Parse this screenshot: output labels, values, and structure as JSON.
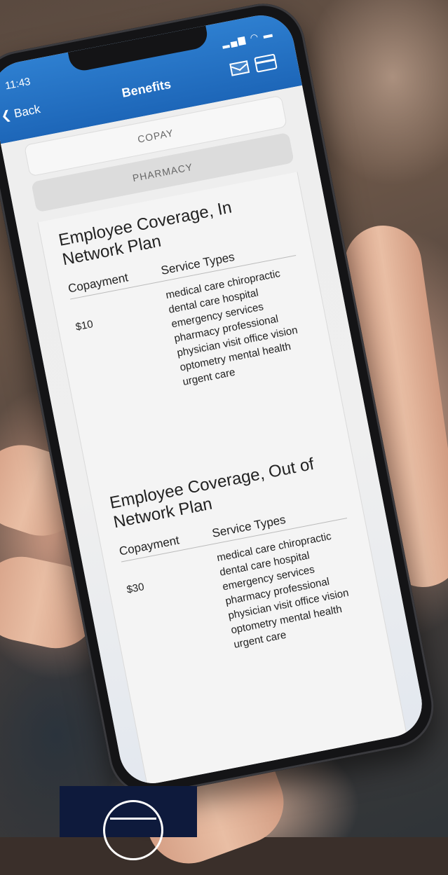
{
  "status": {
    "time": "11:43",
    "icons": "▂▄▆ ◠ ▬"
  },
  "nav": {
    "back_label": "❮ Back",
    "title": "Benefits"
  },
  "tabs": {
    "copay": "COPAY",
    "pharmacy": "PHARMACY"
  },
  "sections": [
    {
      "title": "Employee Coverage, In Network Plan",
      "col_copay": "Copayment",
      "col_service": "Service Types",
      "amount": "$10",
      "services": "medical care chiropractic dental care hospital emergency services pharmacy professional physician visit office vision optometry mental health urgent care"
    },
    {
      "title": "Employee Coverage, Out of Network Plan",
      "col_copay": "Copayment",
      "col_service": "Service Types",
      "amount": "$30",
      "services": "medical care chiropractic dental care hospital emergency services pharmacy professional physician visit office vision optometry mental health urgent care"
    }
  ],
  "colors": {
    "nav_blue": "#1d66b8",
    "logo_navy": "#0e1a3c"
  },
  "icons": [
    "mail-icon",
    "card-icon",
    "back-chevron-icon",
    "logo-icon"
  ]
}
